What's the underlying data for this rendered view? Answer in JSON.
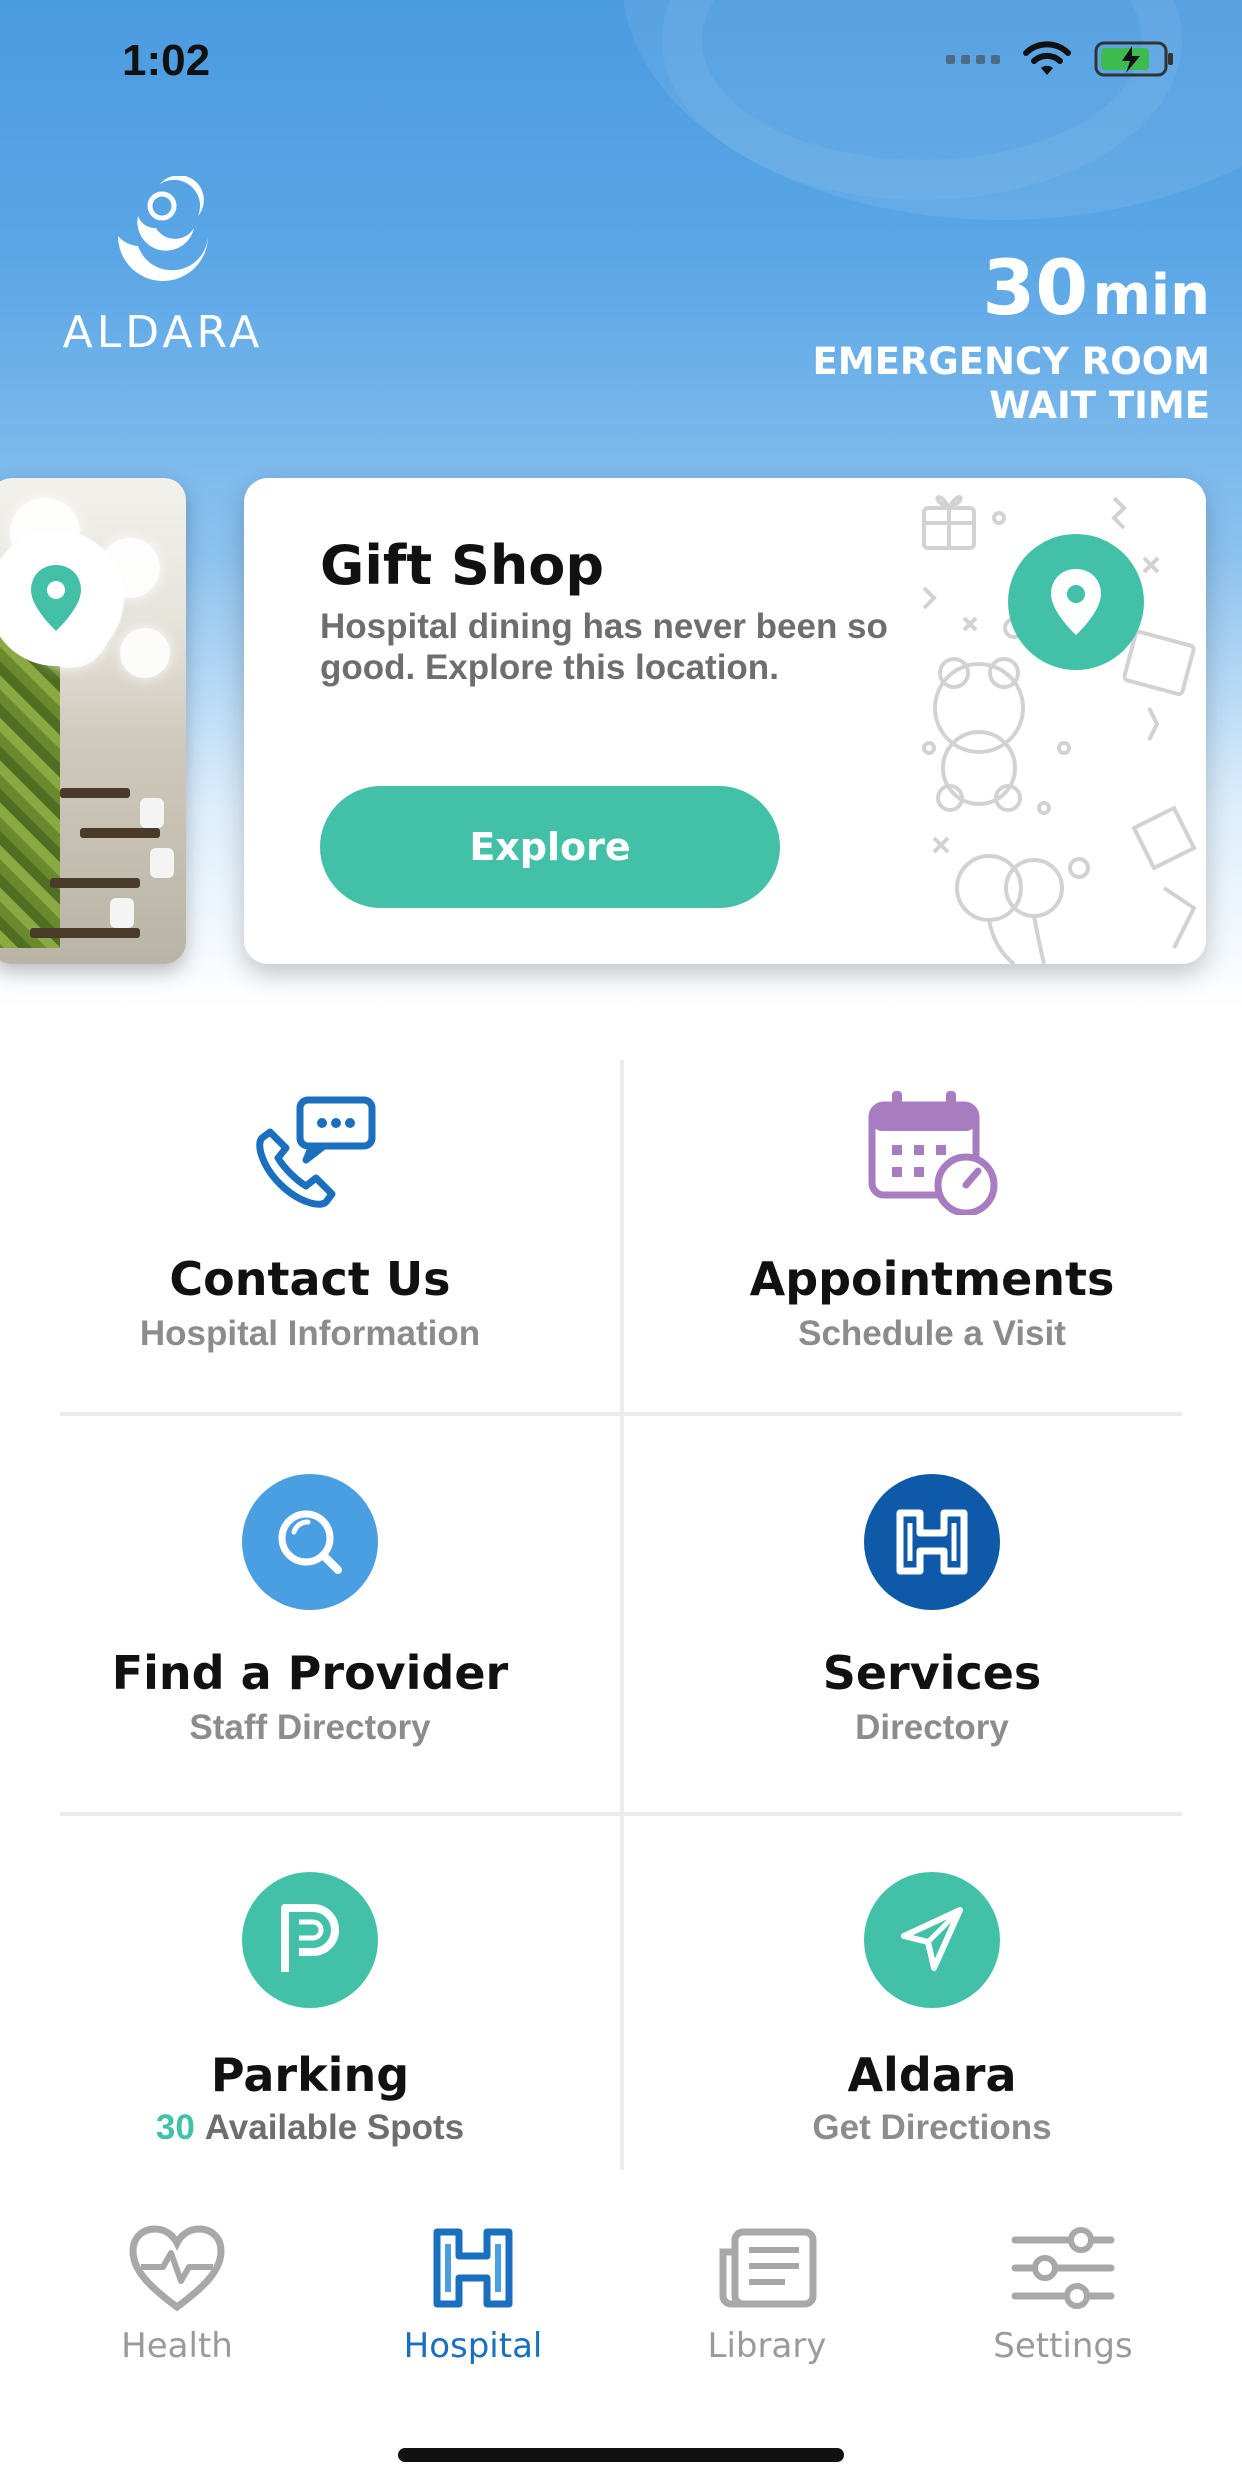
{
  "status_bar": {
    "time": "1:02"
  },
  "header": {
    "logo_text": "ALDARA",
    "wait_number": "30",
    "wait_unit": "min",
    "wait_label_line1": "EMERGENCY ROOM",
    "wait_label_line2": "WAIT TIME"
  },
  "feature_card": {
    "title": "Gift Shop",
    "description": "Hospital dining has never been so good. Explore this location.",
    "button_label": "Explore"
  },
  "grid": {
    "contact": {
      "title": "Contact Us",
      "subtitle": "Hospital Information"
    },
    "appointments": {
      "title": "Appointments",
      "subtitle": "Schedule a Visit"
    },
    "provider": {
      "title": "Find a Provider",
      "subtitle": "Staff Directory"
    },
    "services": {
      "title": "Services",
      "subtitle": "Directory"
    },
    "parking": {
      "title": "Parking",
      "spots": "30",
      "subtitle": "Available Spots"
    },
    "directions": {
      "title": "Aldara",
      "subtitle": "Get Directions"
    }
  },
  "tabs": [
    {
      "label": "Health",
      "icon": "heart-pulse-icon"
    },
    {
      "label": "Hospital",
      "icon": "hospital-h-icon"
    },
    {
      "label": "Library",
      "icon": "library-icon"
    },
    {
      "label": "Settings",
      "icon": "sliders-icon"
    }
  ],
  "colors": {
    "accent_teal": "#43c1a8",
    "accent_blue": "#1b6fbf",
    "purple": "#a77cc0",
    "light_blue": "#4a9fe3",
    "dark_blue": "#0f5aa8"
  }
}
